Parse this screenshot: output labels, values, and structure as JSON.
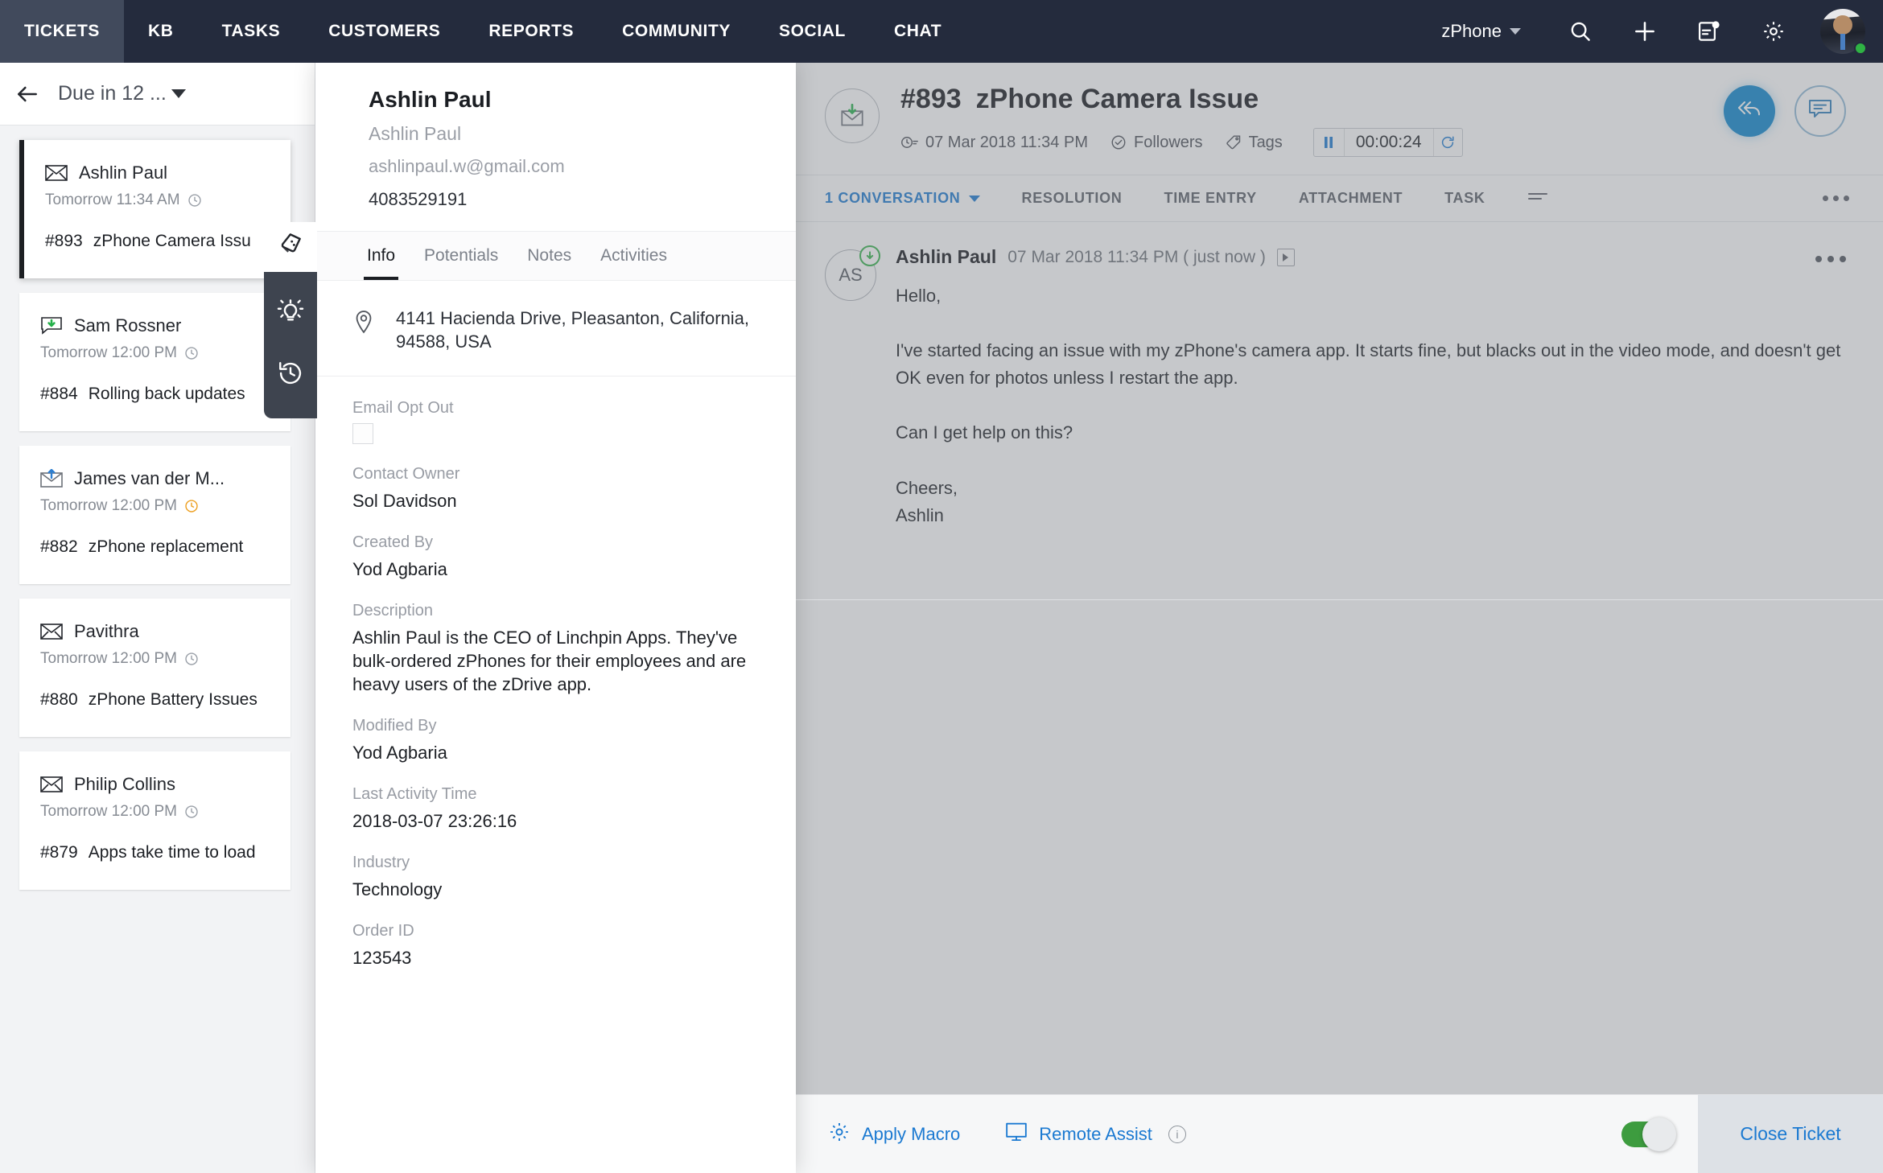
{
  "topnav": {
    "tabs": [
      {
        "label": "TICKETS",
        "active": true
      },
      {
        "label": "KB",
        "active": false
      },
      {
        "label": "TASKS",
        "active": false
      },
      {
        "label": "CUSTOMERS",
        "active": false
      },
      {
        "label": "REPORTS",
        "active": false
      },
      {
        "label": "COMMUNITY",
        "active": false
      },
      {
        "label": "SOCIAL",
        "active": false
      },
      {
        "label": "CHAT",
        "active": false
      }
    ],
    "product": "zPhone",
    "icons": [
      "search-icon",
      "add-icon",
      "notes-notification-icon",
      "gear-icon"
    ],
    "accent": "#242b3d"
  },
  "ticket_list": {
    "header_title": "Due in 12 ...",
    "items": [
      {
        "icon": "envelope-icon",
        "name": "Ashlin Paul",
        "time": "Tomorrow 11:34 AM",
        "clock_color": "#9aa0a8",
        "number": "#893",
        "subject": "zPhone Camera Issu",
        "selected": true
      },
      {
        "icon": "chat-reply-icon",
        "name": "Sam Rossner",
        "time": "Tomorrow 12:00 PM",
        "clock_color": "#9aa0a8",
        "number": "#884",
        "subject": "Rolling back updates",
        "selected": false
      },
      {
        "icon": "envelope-out-icon",
        "name": "James van der M...",
        "time": "Tomorrow 12:00 PM",
        "clock_color": "#eda022",
        "number": "#882",
        "subject": "zPhone replacement",
        "selected": false
      },
      {
        "icon": "envelope-icon",
        "name": "Pavithra",
        "time": "Tomorrow 12:00 PM",
        "clock_color": "#9aa0a8",
        "number": "#880",
        "subject": "zPhone Battery Issues",
        "selected": false
      },
      {
        "icon": "envelope-icon",
        "name": "Philip Collins",
        "time": "Tomorrow 12:00 PM",
        "clock_color": "#9aa0a8",
        "number": "#879",
        "subject": "Apps take time to load",
        "selected": false
      }
    ]
  },
  "minitoolbar": {
    "buttons": [
      "tags-icon",
      "lightbulb-icon",
      "history-icon"
    ]
  },
  "contact": {
    "name": "Ashlin Paul",
    "secondary_name": "Ashlin Paul",
    "email": "ashlinpaul.w@gmail.com",
    "phone": "4083529191",
    "tabs": [
      {
        "label": "Info",
        "active": true
      },
      {
        "label": "Potentials",
        "active": false
      },
      {
        "label": "Notes",
        "active": false
      },
      {
        "label": "Activities",
        "active": false
      }
    ],
    "address": "4141 Hacienda Drive, Pleasanton, California, 94588, USA",
    "fields": [
      {
        "label": "Email Opt Out",
        "value": "",
        "type": "checkbox",
        "checked": false
      },
      {
        "label": "Contact Owner",
        "value": "Sol Davidson",
        "type": "text"
      },
      {
        "label": "Created By",
        "value": "Yod Agbaria",
        "type": "text"
      },
      {
        "label": "Description",
        "value": "Ashlin Paul is the CEO of Linchpin Apps. They've bulk-ordered zPhones for their employees and are heavy users of the zDrive app.",
        "type": "text"
      },
      {
        "label": "Modified By",
        "value": "Yod Agbaria",
        "type": "text"
      },
      {
        "label": "Last Activity Time",
        "value": "2018-03-07 23:26:16",
        "type": "text"
      },
      {
        "label": "Industry",
        "value": "Technology",
        "type": "text"
      },
      {
        "label": "Order ID",
        "value": "123543",
        "type": "text"
      }
    ]
  },
  "ticket": {
    "number": "#893",
    "title": "zPhone Camera Issue",
    "date": "07 Mar 2018 11:34 PM",
    "followers_label": "Followers",
    "tags_label": "Tags",
    "timer_value": "00:00:24",
    "actions": [
      "reply-all-icon",
      "comment-icon"
    ],
    "tabs": [
      {
        "label": "1 CONVERSATION",
        "active": true,
        "has_caret": true
      },
      {
        "label": "RESOLUTION",
        "active": false,
        "has_caret": false
      },
      {
        "label": "TIME ENTRY",
        "active": false,
        "has_caret": false
      },
      {
        "label": "ATTACHMENT",
        "active": false,
        "has_caret": false
      },
      {
        "label": "TASK",
        "active": false,
        "has_caret": false
      }
    ],
    "message": {
      "avatar_initials": "AS",
      "author": "Ashlin Paul",
      "timestamp": "07 Mar 2018 11:34 PM ( just now )",
      "body": "Hello,\n\nI've started facing an issue with my zPhone's camera app. It starts fine, but blacks out in the video mode, and doesn't get OK even for photos unless I restart the app.\n\nCan I get help on this?\n\nCheers,\nAshlin"
    }
  },
  "bottombar": {
    "apply_macro": "Apply Macro",
    "remote_assist": "Remote Assist",
    "info_glyph": "i",
    "close_ticket": "Close Ticket",
    "toggle_on": true,
    "accent": "#1a79d1",
    "toggle_color": "#3d9c3f"
  }
}
